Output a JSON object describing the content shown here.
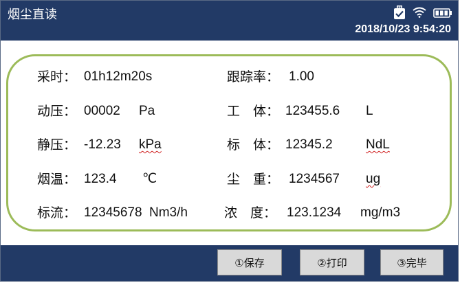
{
  "header": {
    "title": "烟尘直读",
    "datetime": "2018/10/23 9:54:20",
    "icons": [
      "usb-icon",
      "wifi-icon",
      "battery-icon"
    ]
  },
  "measurements": {
    "sampling_time": {
      "label": "采时：",
      "value": "01h12m20s"
    },
    "tracking_rate": {
      "label": "跟踪率：",
      "value": "1.00"
    },
    "dynamic_pressure": {
      "label": "动压：",
      "value": "00002",
      "unit": "Pa"
    },
    "working_volume": {
      "label": "工　体：",
      "value": "123455.6",
      "unit": "L"
    },
    "static_pressure": {
      "label": "静压：",
      "value": "-12.23",
      "unit": "kPa"
    },
    "standard_volume": {
      "label": "标　体：",
      "value": "12345.2",
      "unit": "NdL"
    },
    "flue_temp": {
      "label": "烟温：",
      "value": "123.4",
      "unit": "℃"
    },
    "dust_weight": {
      "label": "尘　重：",
      "value": "1234567",
      "unit": "ug"
    },
    "standard_flow": {
      "label": "标流：",
      "value": "12345678",
      "unit": "Nm3/h"
    },
    "concentration": {
      "label": "浓　度：",
      "value": "123.1234",
      "unit": "mg/m3"
    }
  },
  "footer": {
    "save_label": "①保存",
    "print_label": "②打印",
    "finish_label": "③完毕"
  },
  "colors": {
    "header_bg": "#223a66",
    "panel_border": "#9cbb59",
    "button_bg": "#d9d9d9"
  }
}
